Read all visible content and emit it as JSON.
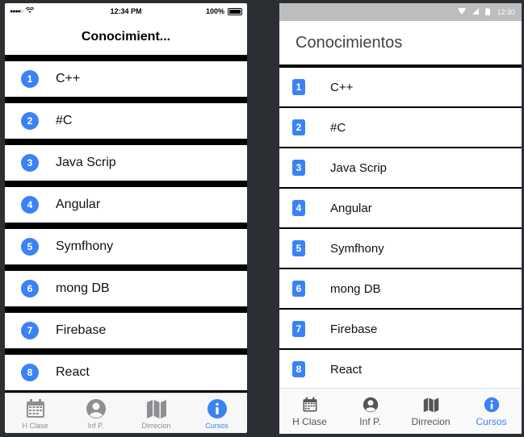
{
  "ios": {
    "status": {
      "time": "12:34 PM",
      "battery": "100%"
    },
    "title": "Conocimient...",
    "items": [
      {
        "num": "1",
        "label": "C++"
      },
      {
        "num": "2",
        "label": "#C"
      },
      {
        "num": "3",
        "label": "Java Scrip"
      },
      {
        "num": "4",
        "label": "Angular"
      },
      {
        "num": "5",
        "label": "Symfhony"
      },
      {
        "num": "6",
        "label": "mong DB"
      },
      {
        "num": "7",
        "label": "Firebase"
      },
      {
        "num": "8",
        "label": "React"
      }
    ],
    "tabs": [
      {
        "label": "H Clase",
        "icon": "calendar-icon"
      },
      {
        "label": "Inf P.",
        "icon": "user-icon"
      },
      {
        "label": "Dirrecion",
        "icon": "map-icon"
      },
      {
        "label": "Cursos",
        "icon": "info-icon",
        "active": true
      }
    ]
  },
  "android": {
    "status": {
      "time": "12:30"
    },
    "title": "Conocimientos",
    "items": [
      {
        "num": "1",
        "label": "C++"
      },
      {
        "num": "2",
        "label": "#C"
      },
      {
        "num": "3",
        "label": "Java Scrip"
      },
      {
        "num": "4",
        "label": "Angular"
      },
      {
        "num": "5",
        "label": "Symfhony"
      },
      {
        "num": "6",
        "label": "mong DB"
      },
      {
        "num": "7",
        "label": "Firebase"
      },
      {
        "num": "8",
        "label": "React"
      }
    ],
    "tabs": [
      {
        "label": "H Clase",
        "icon": "calendar-icon"
      },
      {
        "label": "Inf P.",
        "icon": "user-icon"
      },
      {
        "label": "Dirrecion",
        "icon": "map-icon"
      },
      {
        "label": "Cursos",
        "icon": "info-icon",
        "active": true
      }
    ]
  },
  "colors": {
    "accent": "#3b82f6",
    "ios_inactive": "#8e8e93",
    "android_statusbar": "#bdbdbd"
  }
}
